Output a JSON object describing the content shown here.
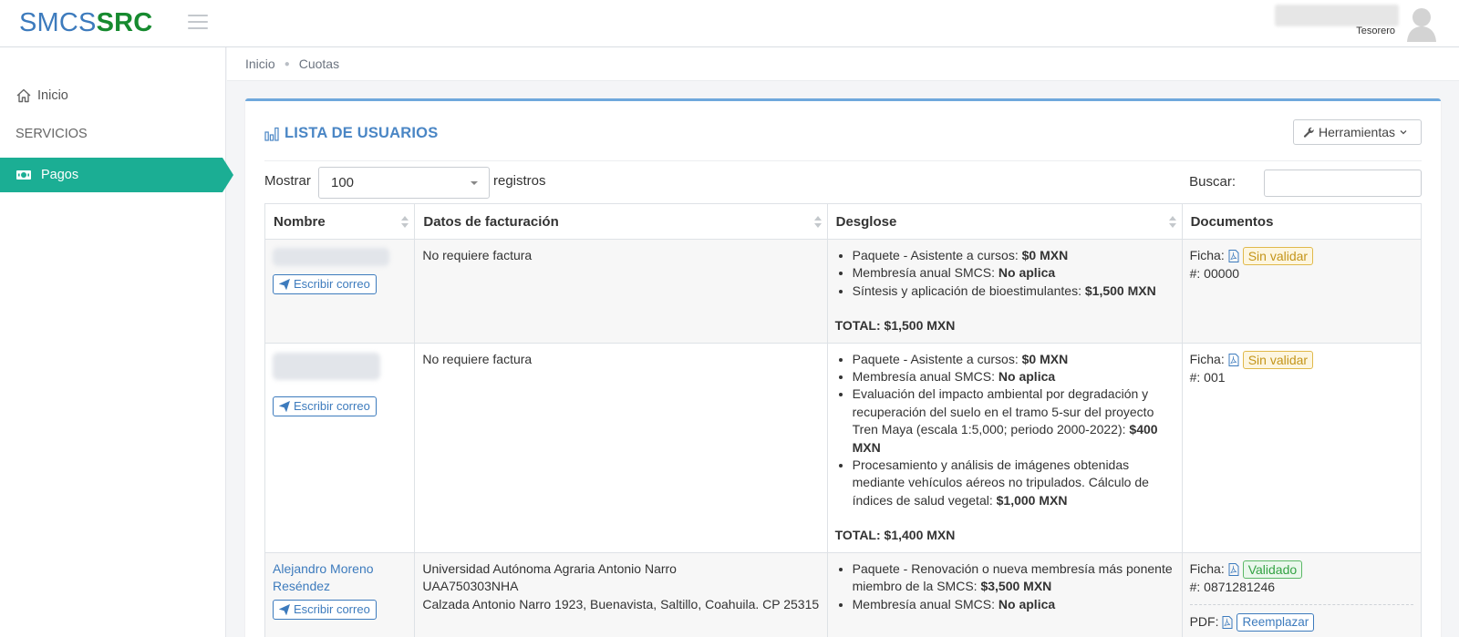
{
  "header": {
    "logo_part1": "SMCS",
    "logo_part2": "SRC",
    "user_role": "Tesorero"
  },
  "sidebar": {
    "home_label": "Inicio",
    "section_label": "SERVICIOS",
    "payments_label": "Pagos"
  },
  "breadcrumb": [
    "Inicio",
    "Cuotas"
  ],
  "card": {
    "title": "LISTA DE USUARIOS",
    "tools_label": "Herramientas"
  },
  "table_controls": {
    "show_label": "Mostrar",
    "page_size": "100",
    "records_label": "registros",
    "search_label": "Buscar:"
  },
  "table": {
    "headers": [
      "Nombre",
      "Datos de facturación",
      "Desglose",
      "Documentos"
    ],
    "email_button": "Escribir correo",
    "rows": [
      {
        "name": "",
        "billing": [
          "No requiere factura"
        ],
        "items": [
          {
            "text": "Paquete - Asistente a cursos: ",
            "amount": "$0 MXN"
          },
          {
            "text": "Membresía anual SMCS: ",
            "amount": "No aplica"
          },
          {
            "text": "Síntesis y aplicación de bioestimulantes: ",
            "amount": "$1,500 MXN"
          }
        ],
        "total": "TOTAL: $1,500 MXN",
        "ficha_label": "Ficha:",
        "status": "Sin validar",
        "number": "#: 00000"
      },
      {
        "name": "",
        "billing": [
          "No requiere factura"
        ],
        "items": [
          {
            "text": "Paquete - Asistente a cursos: ",
            "amount": "$0 MXN"
          },
          {
            "text": "Membresía anual SMCS: ",
            "amount": "No aplica"
          },
          {
            "text": "Evaluación del impacto ambiental por degradación y recuperación del suelo en el tramo 5-sur del proyecto Tren Maya (escala 1:5,000; periodo 2000-2022): ",
            "amount": "$400 MXN"
          },
          {
            "text": "Procesamiento y análisis de imágenes obtenidas mediante vehículos aéreos no tripulados. Cálculo de índices de salud vegetal: ",
            "amount": "$1,000 MXN"
          }
        ],
        "total": "TOTAL: $1,400 MXN",
        "ficha_label": "Ficha:",
        "status": "Sin validar",
        "number": "#: 001"
      },
      {
        "name": "Alejandro Moreno Reséndez",
        "billing": [
          "Universidad Autónoma Agraria Antonio Narro",
          "UAA750303NHA",
          "Calzada Antonio Narro 1923, Buenavista, Saltillo, Coahuila. CP 25315"
        ],
        "items": [
          {
            "text": "Paquete - Renovación o nueva membresía más ponente miembro de la SMCS: ",
            "amount": "$3,500 MXN"
          },
          {
            "text": "Membresía anual SMCS: ",
            "amount": "No aplica"
          }
        ],
        "total": "",
        "ficha_label": "Ficha:",
        "status": "Validado",
        "number": "#: 0871281246",
        "pdf_label": "PDF:",
        "replace_label": "Reemplazar"
      }
    ]
  }
}
